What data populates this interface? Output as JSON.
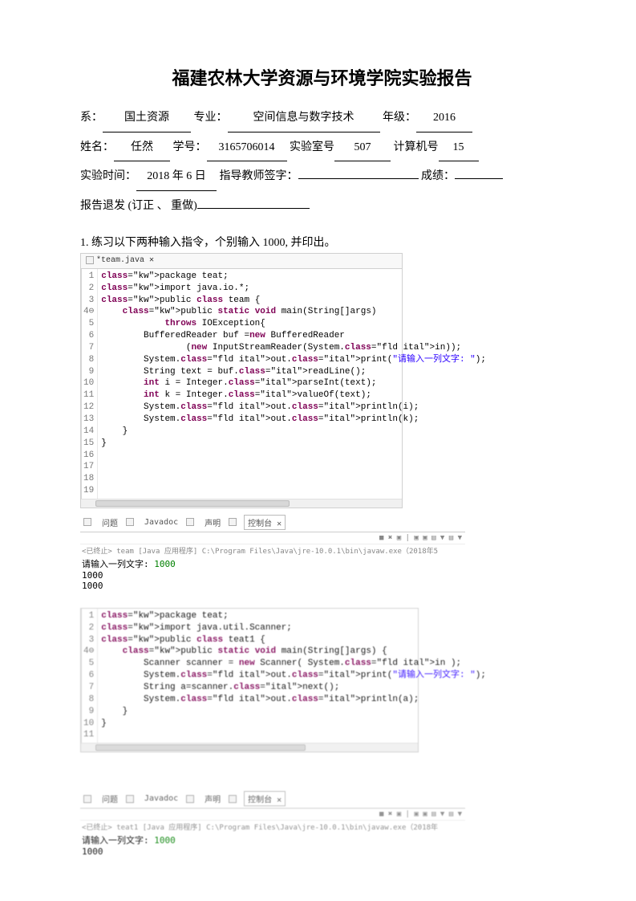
{
  "title": "福建农林大学资源与环境学院实验报告",
  "form": {
    "dept_label": "系：",
    "dept_value": "国土资源",
    "major_label": "专业：",
    "major_value": "空间信息与数字技术",
    "grade_label": "年级：",
    "grade_value": "2016",
    "name_label": "姓名：",
    "name_value": "任然",
    "sid_label": "学号：",
    "sid_value": "3165706014",
    "room_label": "实验室号",
    "room_value": "507",
    "pc_label": "计算机号",
    "pc_value": "15",
    "time_label": "实验时间：",
    "time_value": "2018 年 6 日",
    "teacher_label": "指导教师签字：",
    "teacher_value": "",
    "score_label": "成绩：",
    "score_value": "",
    "return_label": "报告退发  (订正 、 重做)",
    "return_value": ""
  },
  "question1": "1.  练习以下两种输入指令，个别输入  1000, 并印出。",
  "editor1": {
    "tab": "*team.java ✕",
    "lines": [
      "package teat;",
      "import java.io.*;",
      "public class team {",
      "    public static void main(String[]args)",
      "            throws IOException{",
      "        BufferedReader buf =new BufferedReader",
      "                (new InputStreamReader(System.in));",
      "        System.out.print(\"请输入一列文字: \");",
      "        String text = buf.readLine();",
      "        int i = Integer.parseInt(text);",
      "        int k = Integer.valueOf(text);",
      "        System.out.println(i);",
      "        System.out.println(k);",
      "    }",
      "}",
      "",
      "",
      "",
      ""
    ],
    "linenos": [
      "1",
      "2",
      "3",
      "4⊖",
      "5",
      "6",
      "7",
      "8",
      "9",
      "10",
      "11",
      "12",
      "13",
      "14",
      "15",
      "16",
      "17",
      "18",
      "19"
    ]
  },
  "console1": {
    "tabs": [
      "问题",
      "Javadoc",
      "声明",
      "控制台 ✕"
    ],
    "toolbar": "■ ✖ ▣ | ▣ ▣ ▤ ▼ ▤ ▼",
    "header": "<已终止> team [Java 应用程序] C:\\Program Files\\Java\\jre-10.0.1\\bin\\javaw.exe（2018年5",
    "prompt": "请输入一列文字:",
    "input": "1000",
    "out1": "1000",
    "out2": "1000"
  },
  "editor2": {
    "lines": [
      "package teat;",
      "import java.util.Scanner;",
      "public class teat1 {",
      "    public static void main(String[]args) {",
      "        Scanner scanner = new Scanner( System.in );",
      "        System.out.print(\"请输入一列文字: \");",
      "        String a=scanner.next();",
      "        System.out.println(a);",
      "    }",
      "}",
      ""
    ],
    "linenos": [
      "1",
      "2",
      "3",
      "4⊖",
      "5",
      "6",
      "7",
      "8",
      "9",
      "10",
      "11"
    ]
  },
  "console2": {
    "tabs": [
      "问题",
      "Javadoc",
      "声明",
      "控制台 ✕"
    ],
    "toolbar": "■ ✖ ▣ | ▣ ▣ ▤ ▼ ▤ ▼",
    "header": "<已终止> teat1 [Java 应用程序] C:\\Program Files\\Java\\jre-10.0.1\\bin\\javaw.exe（2018年",
    "prompt": "请输入一列文字:",
    "input": "1000",
    "out1": "1000"
  }
}
